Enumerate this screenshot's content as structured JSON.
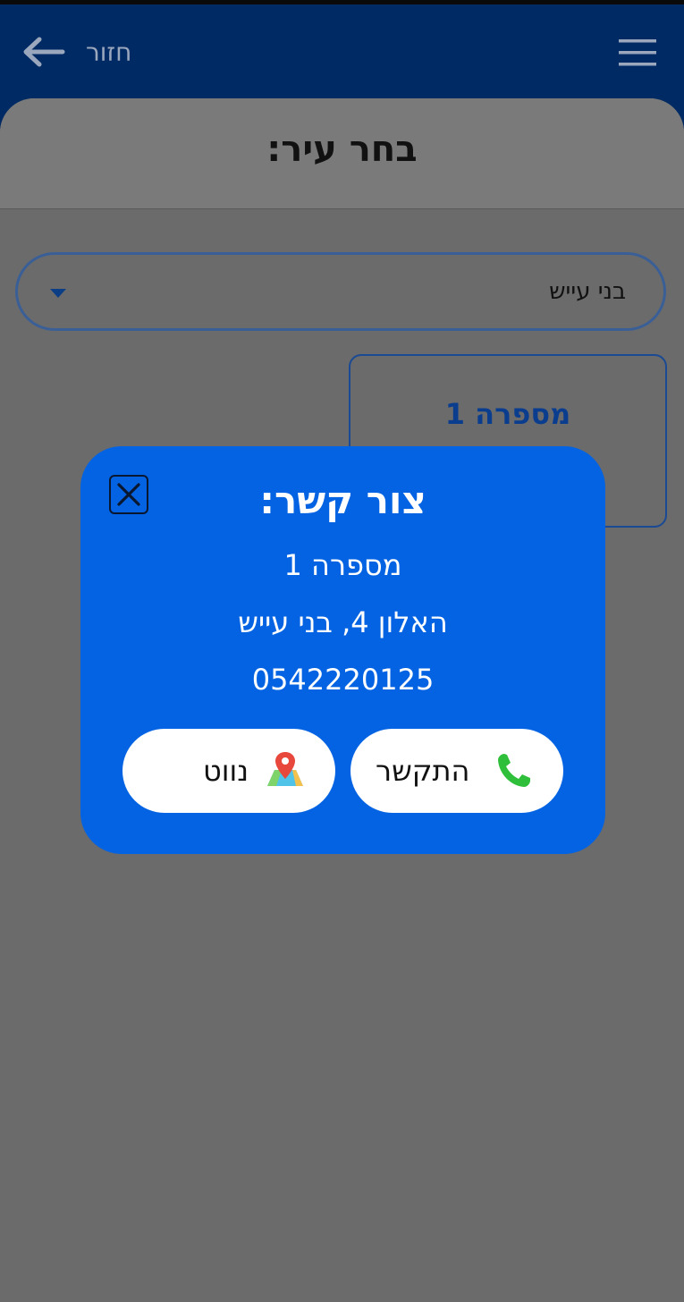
{
  "header": {
    "back_label": "חזור",
    "back_icon": "arrow-left-icon",
    "menu_icon": "hamburger-menu-icon",
    "background_color": "#002a63"
  },
  "sheet": {
    "title": "בחר עיר:"
  },
  "city_select": {
    "selected_value": "בני עייש",
    "arrow_icon": "dropdown-arrow-icon"
  },
  "salon_card": {
    "name": "מספרה 1"
  },
  "contact_modal": {
    "title": "צור קשר:",
    "name": "מספרה 1",
    "address": "האלון 4, בני עייש",
    "phone": "0542220125",
    "close_icon": "close-icon",
    "call_button_label": "התקשר",
    "call_icon": "phone-icon",
    "navigate_button_label": "נווט",
    "navigate_icon": "map-pin-icon",
    "background_color": "#0463e2"
  }
}
